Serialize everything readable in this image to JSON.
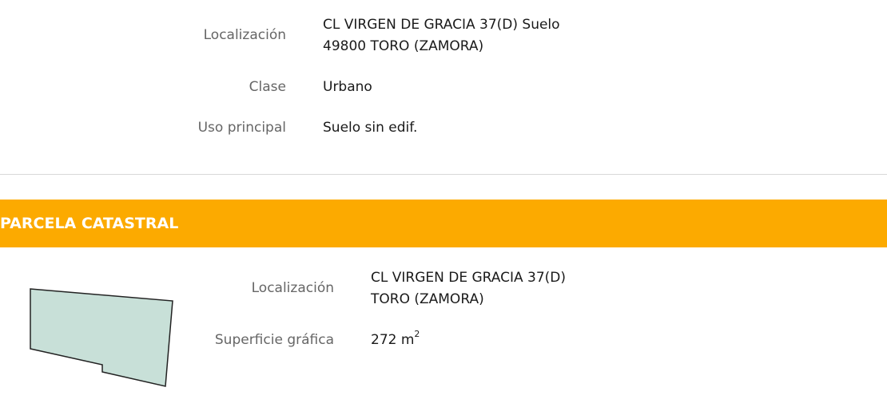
{
  "inmueble": {
    "localizacion_label": "Localización",
    "localizacion_line1": "CL VIRGEN DE GRACIA 37(D) Suelo",
    "localizacion_line2": "49800 TORO (ZAMORA)",
    "clase_label": "Clase",
    "clase_value": "Urbano",
    "uso_label": "Uso principal",
    "uso_value": "Suelo sin edif."
  },
  "parcela": {
    "section_title": "PARCELA CATASTRAL",
    "localizacion_label": "Localización",
    "localizacion_line1": "CL VIRGEN DE GRACIA 37(D)",
    "localizacion_line2": "TORO (ZAMORA)",
    "superficie_label": "Superficie gráfica",
    "superficie_value": "272 m",
    "superficie_unit_exp": "2"
  },
  "colors": {
    "banner": "#fcaa00",
    "parcel_fill": "#c8e0d8",
    "parcel_stroke": "#222222"
  }
}
